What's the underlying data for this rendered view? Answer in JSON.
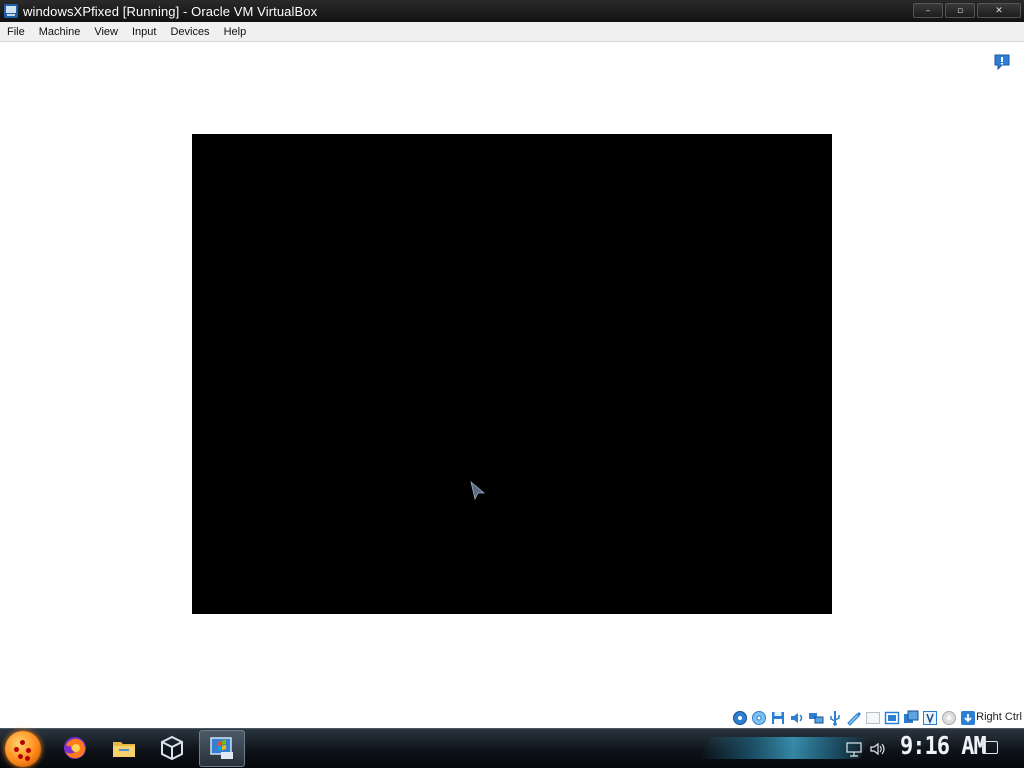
{
  "window": {
    "title": "windowsXPfixed [Running] - Oracle VM VirtualBox",
    "controls": {
      "minimize": "–",
      "maximize": "▫",
      "close": "✕"
    }
  },
  "menu": [
    "File",
    "Machine",
    "View",
    "Input",
    "Devices",
    "Help"
  ],
  "vm": {
    "guest_screen_color": "#000000",
    "notification_icon": "info-bubble-icon"
  },
  "statusbar": {
    "icons": [
      "hard-disk-icon",
      "optical-drive-icon",
      "floppy-drive-icon",
      "audio-icon",
      "network-icon",
      "usb-icon",
      "shared-folders-icon",
      "display-icon",
      "video-capture-icon",
      "cpu-virtualization-icon",
      "mouse-integration-icon",
      "keyboard-capture-icon"
    ],
    "host_key": "Right Ctrl"
  },
  "taskbar": {
    "pinned": [
      "start-orb",
      "firefox-icon",
      "file-explorer-icon",
      "virtualbox-icon",
      "windows-xp-vm-icon"
    ],
    "tray": [
      "network-tray-icon",
      "volume-icon"
    ],
    "clock": "9:16 AM",
    "colors": {
      "accent": "#3ea4c8",
      "orb": "#ff8a1a"
    }
  }
}
